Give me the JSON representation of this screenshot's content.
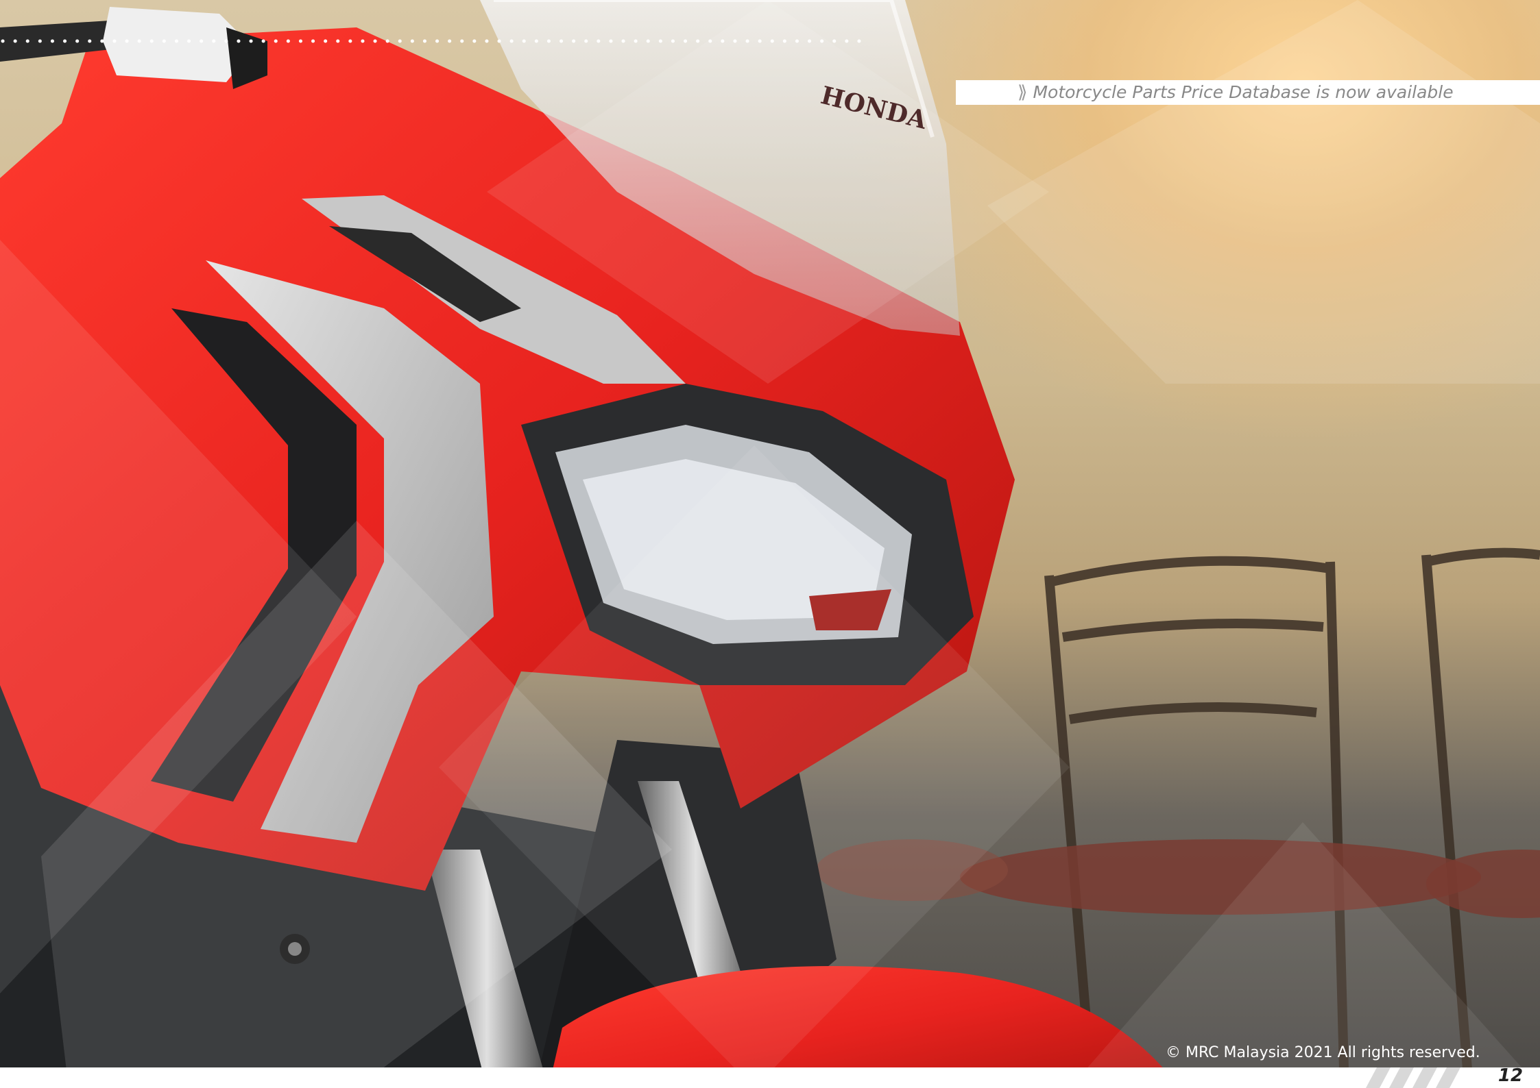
{
  "banner": {
    "prefix_icon": "double-chevron-right-icon",
    "text": "Motorcycle Parts Price Database is now available"
  },
  "footer": {
    "copyright": "© MRC Malaysia 2021 All rights reserved.",
    "page_number": "12"
  },
  "photo": {
    "subject": "motorcycle-front-fairing-photo",
    "brand_mark": "HONDA"
  },
  "colors": {
    "fairing_red": "#e8231f",
    "dots": "#ffffff",
    "banner_bg": "#ffffff",
    "banner_text": "#8a8a8a",
    "footer_text": "#ffffff",
    "page_number_bg": "#ffffff",
    "page_number_text": "#222222"
  }
}
